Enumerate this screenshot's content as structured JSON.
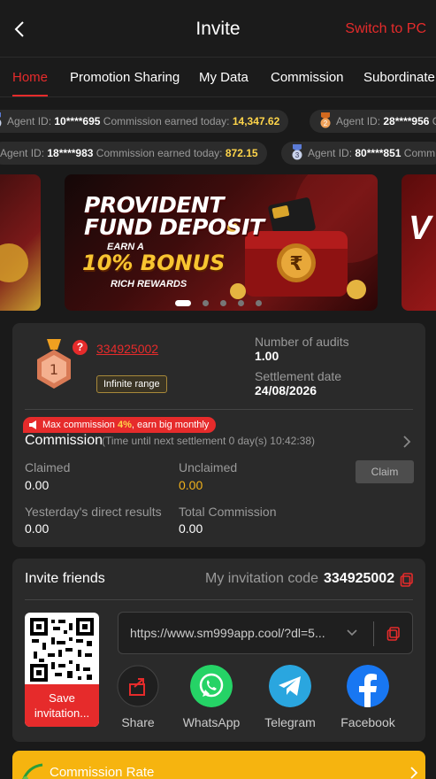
{
  "header": {
    "title": "Invite",
    "switch_label": "Switch to PC"
  },
  "tabs": [
    {
      "label": "Home",
      "active": true
    },
    {
      "label": "Promotion Sharing"
    },
    {
      "label": "My Data"
    },
    {
      "label": "Commission"
    },
    {
      "label": "Subordinate"
    }
  ],
  "ticker": {
    "row1": [
      {
        "id": "10****695",
        "amount": "14,347.62",
        "rank": "1"
      },
      {
        "id": "28****956",
        "rank": "2"
      }
    ],
    "row2": [
      {
        "id": "18****983",
        "amount": "872.15"
      },
      {
        "id": "80****851",
        "rank": "3"
      }
    ],
    "id_label": "Agent ID:",
    "earn_label": "Commission earned today:",
    "comm_cut": "Comm"
  },
  "banner": {
    "line1": "PROVIDENT",
    "line2": "FUND DEPOSIT",
    "line3": "EARN A",
    "line4": "10% BONUS",
    "line5": "RICH REWARDS",
    "right_text": "V",
    "active_slide": 1,
    "slide_count": 5
  },
  "agent": {
    "level": "1",
    "code": "334925002",
    "range": "Infinite range",
    "audits_label": "Number of audits",
    "audits_value": "1.00",
    "settlement_label": "Settlement date",
    "settlement_value": "24/08/2026",
    "max_commission_prefix": "Max commission ",
    "max_commission_pct": "4%",
    "max_commission_suffix": ", earn big monthly",
    "commission_title": "Commission",
    "countdown": "(Time until next settlement  0 day(s) 10:42:38)",
    "claimed_label": "Claimed",
    "claimed_value": "0.00",
    "unclaimed_label": "Unclaimed",
    "unclaimed_value": "0.00",
    "claim_button": "Claim",
    "yesterday_label": "Yesterday's direct results",
    "yesterday_value": "0.00",
    "total_label": "Total Commission",
    "total_value": "0.00"
  },
  "invite": {
    "title": "Invite friends",
    "code_label": "My invitation code",
    "code": "334925002",
    "save_button": "Save invitation...",
    "link": "https://www.sm999app.cool/?dl=5...",
    "share": [
      {
        "label": "Share",
        "icon": "share-icon"
      },
      {
        "label": "WhatsApp",
        "icon": "whatsapp-icon"
      },
      {
        "label": "Telegram",
        "icon": "telegram-icon"
      },
      {
        "label": "Facebook",
        "icon": "facebook-icon"
      }
    ]
  },
  "rate": {
    "label": "Commission Rate"
  },
  "colors": {
    "accent": "#e62b2b",
    "gold": "#ffd54a",
    "panel": "#2a2a2a",
    "background": "#1a1a1a",
    "rate_bar": "#f6b40f"
  }
}
